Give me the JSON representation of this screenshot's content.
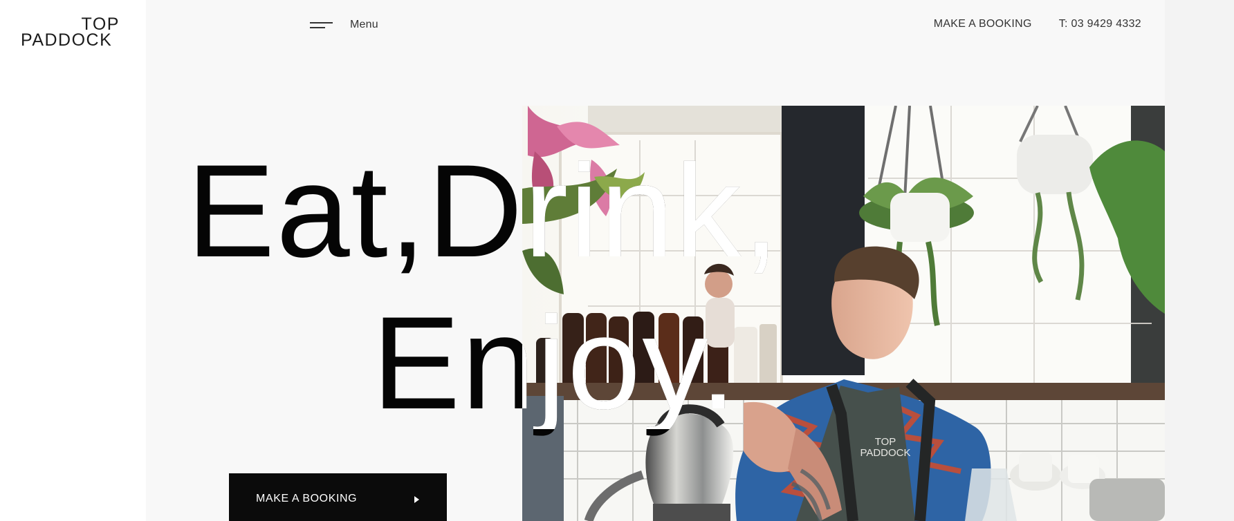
{
  "brand": {
    "logo_top": "TOP",
    "logo_bottom": "PADDOCK"
  },
  "header": {
    "menu_label": "Menu",
    "booking_label": "MAKE A BOOKING",
    "phone_label": "T: 03 9429 4332"
  },
  "hero": {
    "line_1": "Eat,Drink,",
    "line_2": "Enjoy.",
    "button_label": "MAKE A BOOKING",
    "image": {
      "apron_logo_top": "TOP",
      "apron_logo_bottom": "PADDOCK"
    }
  },
  "theme": {
    "dark_text": "#050505",
    "light_text": "#ffffff",
    "page_background": "#f8f8f8",
    "button_background": "#0b0b0b"
  },
  "icons": {
    "menu": "hamburger-menu-icon",
    "button_arrow": "play-arrow-icon"
  }
}
